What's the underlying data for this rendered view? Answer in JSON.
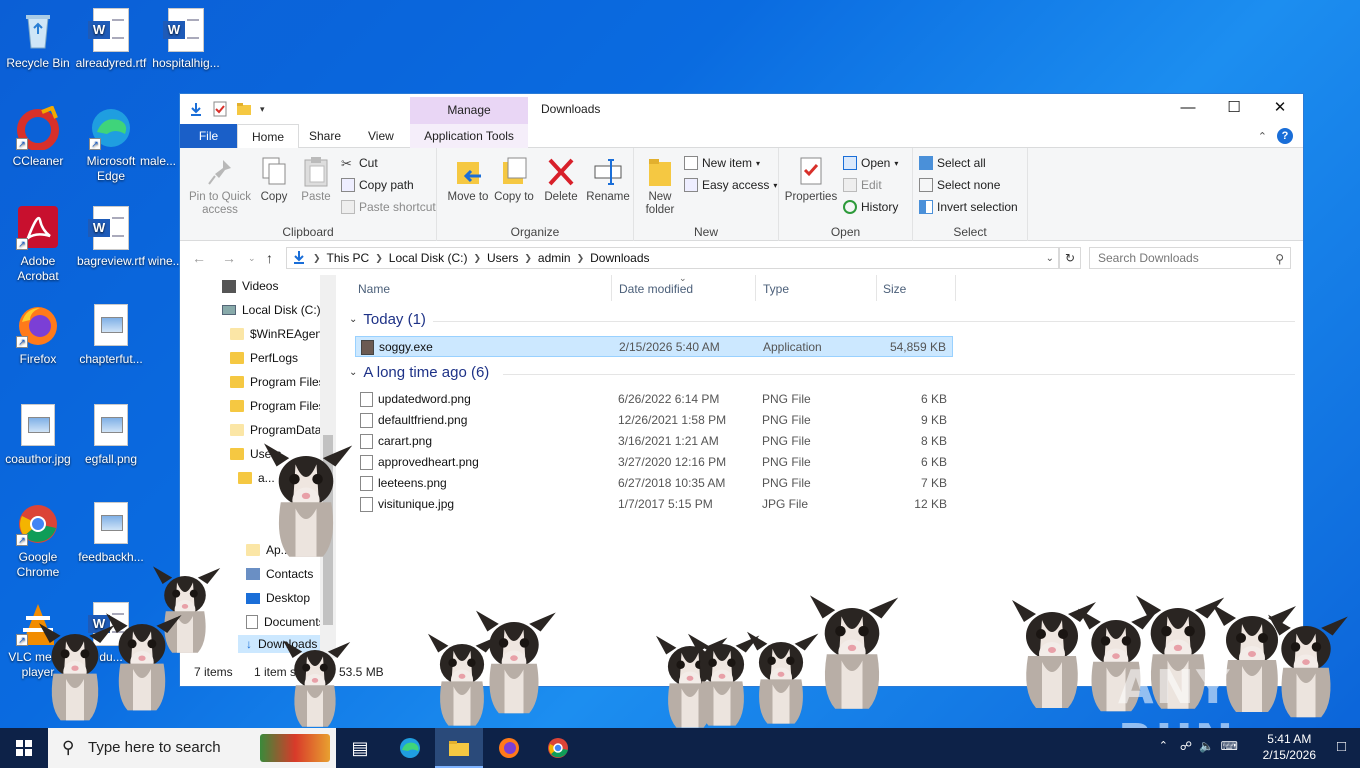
{
  "desktop": {
    "icons": [
      {
        "label": "Recycle Bin"
      },
      {
        "label": "alreadyred.rtf"
      },
      {
        "label": "hospitalhig..."
      },
      {
        "label": "CCleaner"
      },
      {
        "label": "Microsoft Edge"
      },
      {
        "label": "male..."
      },
      {
        "label": "Adobe Acrobat"
      },
      {
        "label": "bagreview.rtf"
      },
      {
        "label": "wine..."
      },
      {
        "label": "Firefox"
      },
      {
        "label": "chapterfut..."
      },
      {
        "label": "coauthor.jpg"
      },
      {
        "label": "egfall.png"
      },
      {
        "label": "Google Chrome"
      },
      {
        "label": "feedbackh..."
      },
      {
        "label": "VLC media player"
      },
      {
        "label": "du..."
      }
    ]
  },
  "window": {
    "title": "Downloads",
    "manage_label": "Manage",
    "tabs": {
      "file": "File",
      "home": "Home",
      "share": "Share",
      "view": "View",
      "app_tools": "Application Tools"
    },
    "ribbon": {
      "clipboard": {
        "label": "Clipboard",
        "pin": "Pin to Quick access",
        "copy": "Copy",
        "paste": "Paste",
        "cut": "Cut",
        "copy_path": "Copy path",
        "paste_shortcut": "Paste shortcut"
      },
      "organize": {
        "label": "Organize",
        "move_to": "Move to",
        "copy_to": "Copy to",
        "delete": "Delete",
        "rename": "Rename"
      },
      "new": {
        "label": "New",
        "new_folder": "New folder",
        "new_item": "New item",
        "easy_access": "Easy access"
      },
      "open": {
        "label": "Open",
        "properties": "Properties",
        "open": "Open",
        "edit": "Edit",
        "history": "History"
      },
      "select": {
        "label": "Select",
        "select_all": "Select all",
        "select_none": "Select none",
        "invert": "Invert selection"
      }
    },
    "address": {
      "crumbs": [
        "This PC",
        "Local Disk (C:)",
        "Users",
        "admin",
        "Downloads"
      ],
      "search_placeholder": "Search Downloads"
    },
    "nav": {
      "items": [
        "Videos",
        "Local Disk (C:)",
        "$WinREAgent",
        "PerfLogs",
        "Program Files",
        "Program Files",
        "ProgramData",
        "Users",
        "a...",
        "Ap...",
        "Contacts",
        "Desktop",
        "Documents",
        "Downloads"
      ]
    },
    "columns": {
      "name": "Name",
      "date": "Date modified",
      "type": "Type",
      "size": "Size"
    },
    "groups": [
      {
        "title": "Today (1)",
        "files": [
          {
            "name": "soggy.exe",
            "date": "2/15/2026 5:40 AM",
            "type": "Application",
            "size": "54,859 KB"
          }
        ]
      },
      {
        "title": "A long time ago (6)",
        "files": [
          {
            "name": "updatedword.png",
            "date": "6/26/2022 6:14 PM",
            "type": "PNG File",
            "size": "6 KB"
          },
          {
            "name": "defaultfriend.png",
            "date": "12/26/2021 1:58 PM",
            "type": "PNG File",
            "size": "9 KB"
          },
          {
            "name": "carart.png",
            "date": "3/16/2021 1:21 AM",
            "type": "PNG File",
            "size": "8 KB"
          },
          {
            "name": "approvedheart.png",
            "date": "3/27/2020 12:16 PM",
            "type": "PNG File",
            "size": "6 KB"
          },
          {
            "name": "leeteens.png",
            "date": "6/27/2018 10:35 AM",
            "type": "PNG File",
            "size": "7 KB"
          },
          {
            "name": "visitunique.jpg",
            "date": "1/7/2017 5:15 PM",
            "type": "JPG File",
            "size": "12 KB"
          }
        ]
      }
    ],
    "status": {
      "count": "7 items",
      "selected": "1 item s",
      "size": "53.5 MB"
    }
  },
  "watermark": "ANY RUN",
  "taskbar": {
    "search_placeholder": "Type here to search",
    "time": "5:41 AM",
    "date": "2/15/2026"
  },
  "colors": {
    "accent": "#1a5fc8",
    "selection": "#cce8ff",
    "group_header": "#1e3287",
    "taskbar": "#0d2248"
  }
}
